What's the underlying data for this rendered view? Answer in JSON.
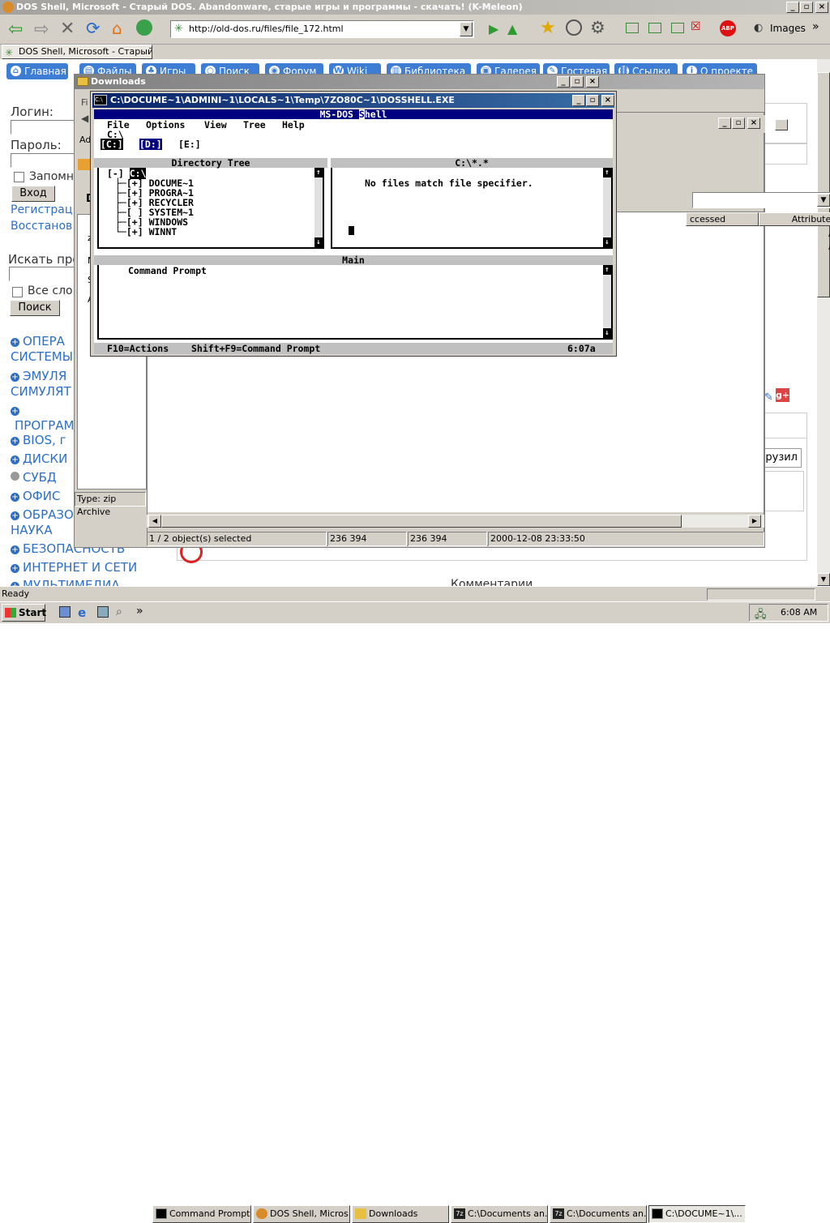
{
  "browser": {
    "title": "DOS Shell, Microsoft - Старый DOS. Abandonware, старые игры и программы - скачать! (K-Meleon)",
    "url": "http://old-dos.ru/files/file_172.html",
    "images_label": "Images",
    "tab_label": "DOS Shell, Microsoft - Старый ...",
    "status": "Ready"
  },
  "site": {
    "nav": [
      "Главная",
      "Файлы",
      "Игры",
      "Поиск",
      "Форум",
      "Wiki",
      "Библиотека",
      "Галерея",
      "Гостевая",
      "Ссылки",
      "О проекте"
    ],
    "login_label": "Логин:",
    "password_label": "Пароль:",
    "remember_label": "Запомн",
    "login_button": "Вход",
    "register_link": "Регистрац",
    "restore_link": "Восстанов",
    "search_label": "Искать про",
    "all_words_label": "Все сло",
    "search_button": "Поиск",
    "categories": [
      {
        "l1": "ОПЕРА",
        "l2": "СИСТЕМЫ"
      },
      {
        "l1": "ЭМУЛЯ",
        "l2": "СИМУЛЯТ"
      },
      {
        "l1": "",
        "l2": "ПРОГРАММ"
      },
      {
        "l1": "BIOS, г",
        "l2": ""
      },
      {
        "l1": "ДИСКИ",
        "l2": ""
      },
      {
        "l1": "СУБД",
        "l2": ""
      },
      {
        "l1": "ОФИС",
        "l2": ""
      },
      {
        "l1": "ОБРАЗОВАНИЕ И",
        "l2": "НАУКА"
      },
      {
        "l1": "БЕЗОПАСНОСТЬ",
        "l2": ""
      },
      {
        "l1": "ИНТЕРНЕТ И СЕТИ",
        "l2": ""
      },
      {
        "l1": "МУЛЬТИМЕДИА",
        "l2": ""
      }
    ],
    "comments_label": "Комментарии",
    "upload_button": "грузил"
  },
  "downloads": {
    "title": "Downloads",
    "col_accessed": "ccessed",
    "col_attributes": "Attributes",
    "attr_values": [
      "A",
      "A"
    ],
    "left_labels": [
      "Fi",
      "Ad",
      "D",
      "z",
      "M",
      "S",
      "A"
    ],
    "type_status": "Type: zip Archive",
    "status_selected": "1 / 2 object(s) selected",
    "status_size1": "236 394",
    "status_size2": "236 394",
    "status_date": "2000-12-08 23:33:50"
  },
  "cmd": {
    "title": "C:\\DOCUME~1\\ADMINI~1\\LOCALS~1\\Temp\\7ZO80C~1\\DOSSHELL.EXE"
  },
  "dosshell": {
    "app_title_1": "MS-DOS ",
    "app_title_2": "S",
    "app_title_3": "hell",
    "menu": [
      "File",
      "Options",
      "View",
      "Tree",
      "Help"
    ],
    "path": "C:\\",
    "drives": [
      "[C:]",
      "[D:]",
      "[E:]"
    ],
    "tree_header": "Directory Tree",
    "tree_root_prefix": "[-] ",
    "tree_root": "C:\\",
    "tree": [
      {
        "branch": "├─",
        "mark": "[+]",
        "name": "DOCUME~1"
      },
      {
        "branch": "├─",
        "mark": "[+]",
        "name": "PROGRA~1"
      },
      {
        "branch": "├─",
        "mark": "[+]",
        "name": "RECYCLER"
      },
      {
        "branch": "├─",
        "mark": "[ ]",
        "name": "SYSTEM~1"
      },
      {
        "branch": "├─",
        "mark": "[+]",
        "name": "WINDOWS"
      },
      {
        "branch": "└─",
        "mark": "[+]",
        "name": "WINNT"
      }
    ],
    "files_header": "C:\\*.*",
    "no_files": "No files match file specifier.",
    "main_header": "Main",
    "main_item": "Command Prompt",
    "status_actions": "F10=Actions",
    "status_prompt": "Shift+F9=Command Prompt",
    "time": "6:07a"
  },
  "taskbar": {
    "start": "Start",
    "tasks": [
      "Command Prompt",
      "DOS Shell, Micros...",
      "Downloads",
      "C:\\Documents an...",
      "C:\\Documents an...",
      "C:\\DOCUME~1\\..."
    ],
    "clock": "6:08 AM"
  },
  "colors": {
    "accent": "#3d7dd3",
    "dos_title": "#000080",
    "xp_title": "#0a246a",
    "tray_bg": "#d4d0c8"
  }
}
